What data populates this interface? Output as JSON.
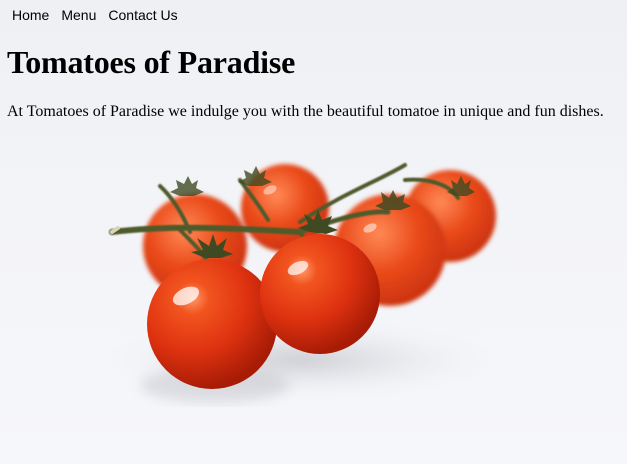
{
  "nav": {
    "items": [
      {
        "label": "Home"
      },
      {
        "label": "Menu"
      },
      {
        "label": "Contact Us"
      }
    ]
  },
  "page": {
    "title": "Tomatoes of Paradise",
    "intro": "At Tomatoes of Paradise we indulge you with the beautiful tomatoe in unique and fun dishes."
  },
  "hero": {
    "tomato_color": "#e23a10",
    "vine_color": "#4f5a2a"
  }
}
